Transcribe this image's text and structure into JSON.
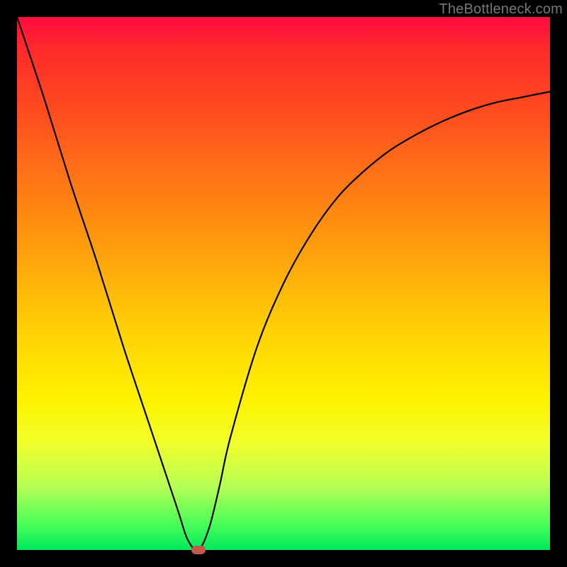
{
  "watermark": "TheBottleneck.com",
  "chart_data": {
    "type": "line",
    "title": "",
    "xlabel": "",
    "ylabel": "",
    "xlim": [
      0,
      100
    ],
    "ylim": [
      0,
      100
    ],
    "grid": false,
    "legend": false,
    "series": [
      {
        "name": "bottleneck-curve",
        "x": [
          0,
          5,
          10,
          15,
          20,
          25,
          30,
          32,
          34,
          36,
          38,
          40,
          45,
          50,
          55,
          60,
          65,
          70,
          75,
          80,
          85,
          90,
          95,
          100
        ],
        "values": [
          100,
          85,
          69,
          54,
          38,
          23,
          8,
          2,
          0,
          4,
          12,
          21,
          38,
          50,
          59,
          66,
          71,
          75,
          78,
          80.5,
          82.5,
          84,
          85,
          86
        ]
      }
    ],
    "annotations": [
      {
        "name": "minimum-marker",
        "x": 34,
        "y": 0
      }
    ],
    "background_gradient": {
      "top": "#ff0b3f",
      "mid": "#fff300",
      "bottom": "#00e85e"
    }
  },
  "colors": {
    "frame": "#000000",
    "curve": "#000000",
    "marker": "#c05a4b",
    "watermark": "#777777"
  }
}
